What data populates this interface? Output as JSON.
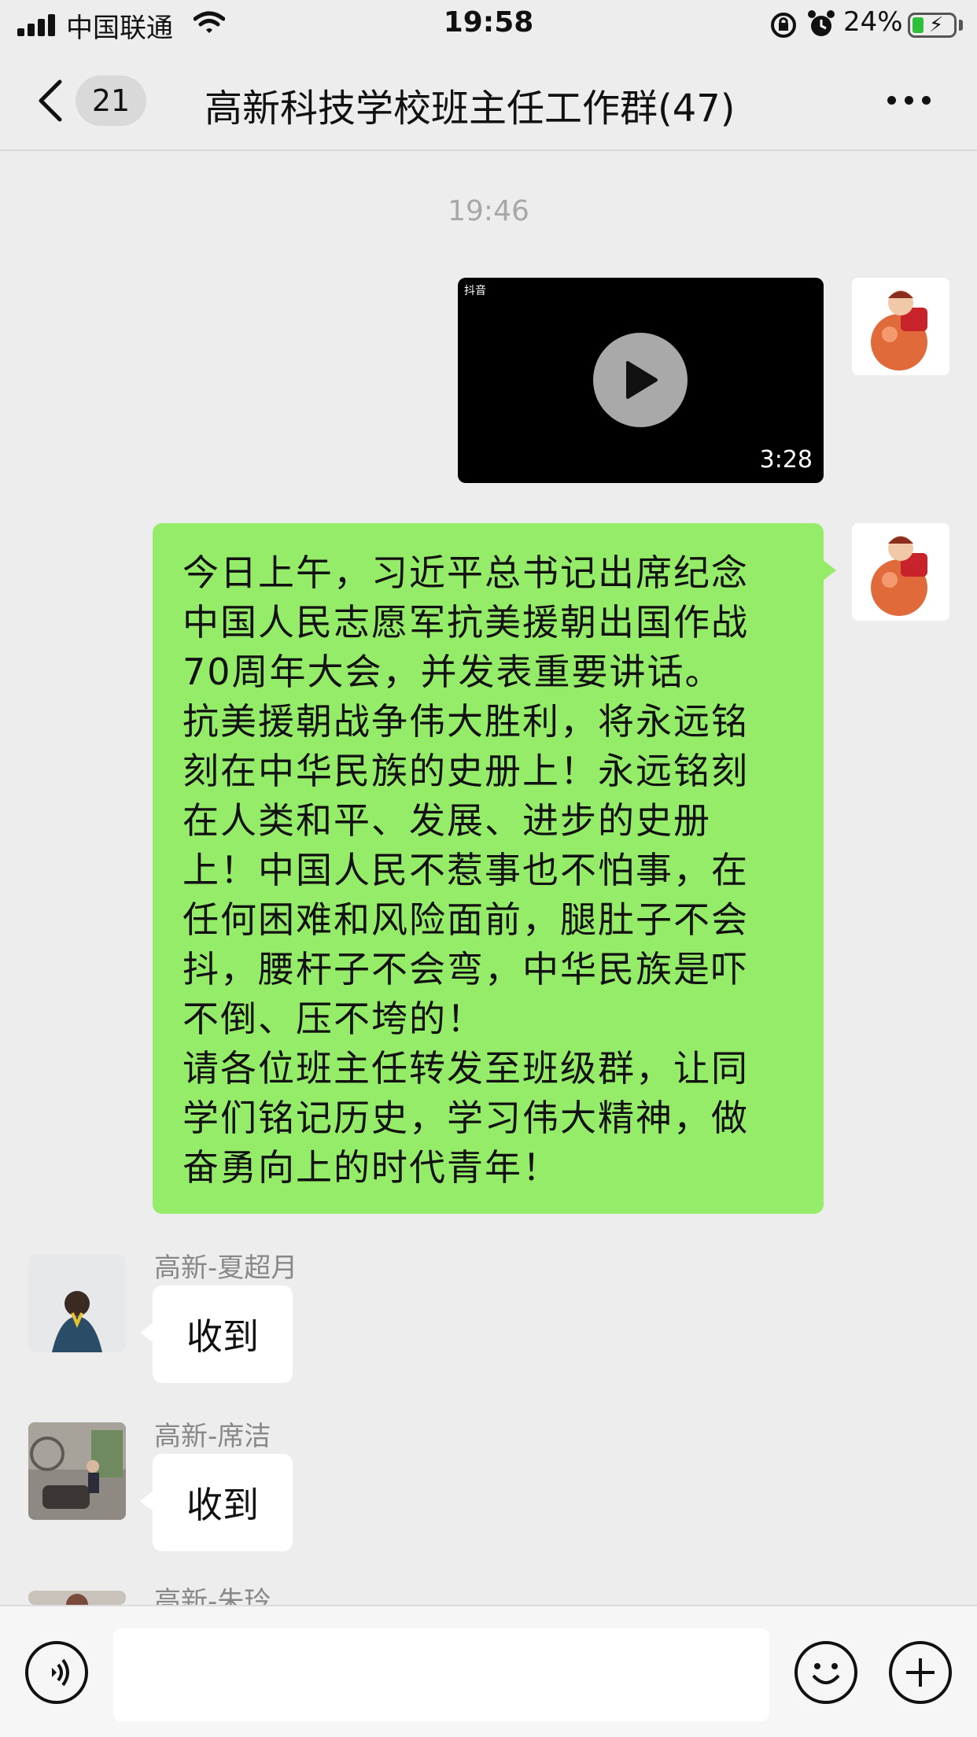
{
  "status_bar": {
    "carrier": "中国联通",
    "time": "19:58",
    "battery_percent": "24%",
    "battery_level": 0.24
  },
  "nav": {
    "unread_count": "21",
    "title": "高新科技学校班主任工作群(47)"
  },
  "messages": {
    "timestamp": "19:46",
    "video": {
      "source_logo": "抖音",
      "duration": "3:28"
    },
    "text_message": "今日上午，习近平总书记出席纪念\n中国人民志愿军抗美援朝出国作战\n70周年大会，并发表重要讲话。\n抗美援朝战争伟大胜利，将永远铭\n刻在中华民族的史册上！永远铭刻\n在人类和平、发展、进步的史册\n上！中国人民不惹事也不怕事，在\n任何困难和风险面前，腿肚子不会\n抖，腰杆子不会弯，中华民族是吓\n不倒、压不垮的！\n请各位班主任转发至班级群，让同\n学们铭记历史，学习伟大精神，做\n奋勇向上的时代青年！",
    "replies": [
      {
        "sender": "高新-夏超月",
        "text": "收到"
      },
      {
        "sender": "高新-席洁",
        "text": "收到"
      },
      {
        "sender": "高新-朱玲",
        "text": ""
      }
    ]
  },
  "input": {
    "placeholder": ""
  },
  "colors": {
    "background": "#ededed",
    "bubble_self": "#95ec69",
    "bubble_other": "#ffffff",
    "battery_fill": "#2fbf3c"
  },
  "icons": [
    "signal-icon",
    "wifi-icon",
    "rotation-lock-icon",
    "alarm-icon",
    "battery-icon",
    "back-chevron-icon",
    "more-dots-icon",
    "play-icon",
    "voice-icon",
    "emoji-icon",
    "plus-icon"
  ]
}
